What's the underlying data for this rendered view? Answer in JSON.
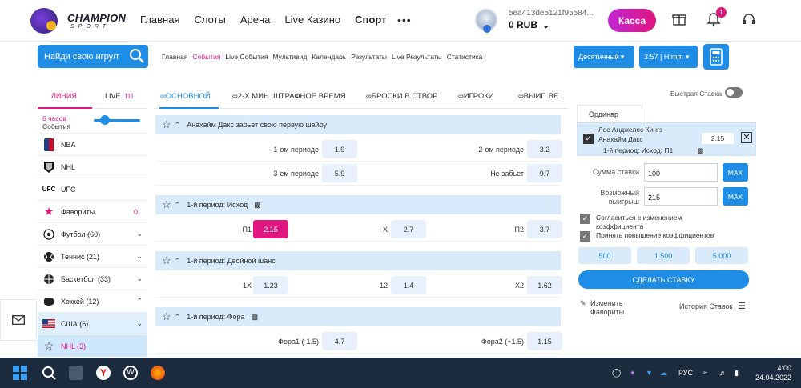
{
  "header": {
    "logo_title": "CHAMPION",
    "logo_sub": "SPORT",
    "nav": [
      "Главная",
      "Слоты",
      "Арена",
      "Live Казино",
      "Спорт"
    ],
    "more": "•••",
    "user_id": "5ea413de5121f95584...",
    "balance": "0 RUB",
    "kassa": "Касса",
    "notifications": "1"
  },
  "toolbar": {
    "search_placeholder": "Найди свою игру/т",
    "links": [
      "Главная",
      "События",
      "Live События",
      "Мультивид",
      "Календарь",
      "Результаты",
      "Live Результаты",
      "Статистика"
    ],
    "active_link": "События",
    "odds_format": "Десятичный",
    "time_format": "3:57 | H:mm"
  },
  "left": {
    "tab_line": "ЛИНИЯ",
    "tab_live": "LIVE",
    "live_count": "111",
    "hours": "6 часов",
    "events": "События",
    "sports": [
      {
        "name": "NBA",
        "icon": "nba-icon"
      },
      {
        "name": "NHL",
        "icon": "nhl-icon"
      },
      {
        "name": "UFC",
        "icon": "ufc-icon"
      },
      {
        "name": "Фавориты",
        "icon": "star-icon",
        "count": "0"
      },
      {
        "name": "Футбол (60)",
        "icon": "soccer-icon"
      },
      {
        "name": "Теннис (21)",
        "icon": "tennis-icon"
      },
      {
        "name": "Баскетбол (33)",
        "icon": "basketball-icon"
      },
      {
        "name": "Хоккей (12)",
        "icon": "hockey-icon"
      },
      {
        "name": "США (6)",
        "icon": "usa-flag-icon"
      },
      {
        "name": "NHL (3)",
        "icon": "star-icon"
      }
    ]
  },
  "center": {
    "tabs": [
      "ОСНОВНОЙ",
      "2-Х МИН. ШТРАФНОЕ ВРЕМЯ",
      "БРОСКИ В СТВОР",
      "ИГРОКИ",
      "ВЫИГ. ВЕ"
    ],
    "markets": [
      {
        "title": "Анахайм Дакс забьет свою первую шайбу",
        "rows": [
          [
            {
              "label": "1-ом периоде",
              "odd": "1.9"
            },
            {
              "label": "2-ом периоде",
              "odd": "3.2"
            }
          ],
          [
            {
              "label": "3-ем периоде",
              "odd": "5.9"
            },
            {
              "label": "Не забьет",
              "odd": "9.7"
            }
          ]
        ]
      },
      {
        "title": "1-й период: Исход",
        "rows": [
          [
            {
              "label": "П1",
              "odd": "2.15"
            },
            {
              "label": "Х",
              "odd": "2.7"
            },
            {
              "label": "П2",
              "odd": "3.7"
            }
          ]
        ]
      },
      {
        "title": "1-й период: Двойной шанс",
        "rows": [
          [
            {
              "label": "1Х",
              "odd": "1.23"
            },
            {
              "label": "12",
              "odd": "1.4"
            },
            {
              "label": "Х2",
              "odd": "1.62"
            }
          ]
        ]
      },
      {
        "title": "1-й период: Фора",
        "rows": [
          [
            {
              "label": "Фора1 (-1.5)",
              "odd": "4.7"
            },
            {
              "label": "Фора2 (+1.5)",
              "odd": "1.15"
            }
          ]
        ]
      }
    ]
  },
  "slip": {
    "fast_bet": "Быстрая Ставка",
    "tab": "Ординар",
    "match_line1": "Лос Анджелес Кингз",
    "match_line2": "Анахайм Дакс",
    "market": "1-й период: Исход: П1",
    "odd": "2.15",
    "stake_label": "Сумма ставки",
    "stake": "100",
    "win_label1": "Возможный",
    "win_label2": "выигрыш",
    "win": "215",
    "max": "MAX",
    "cb1a": "Согласиться с изменением",
    "cb1b": "коэффициента",
    "cb2": "Принять повышение коэффициентов",
    "quick": [
      "500",
      "1 500",
      "5 000"
    ],
    "make_bet": "СДЕЛАТЬ СТАВКУ",
    "fav1": "Изменить",
    "fav2": "Фавориты",
    "history": "История Ставок"
  },
  "taskbar": {
    "lang": "РУС",
    "time": "4:00",
    "date": "24.04.2022"
  }
}
